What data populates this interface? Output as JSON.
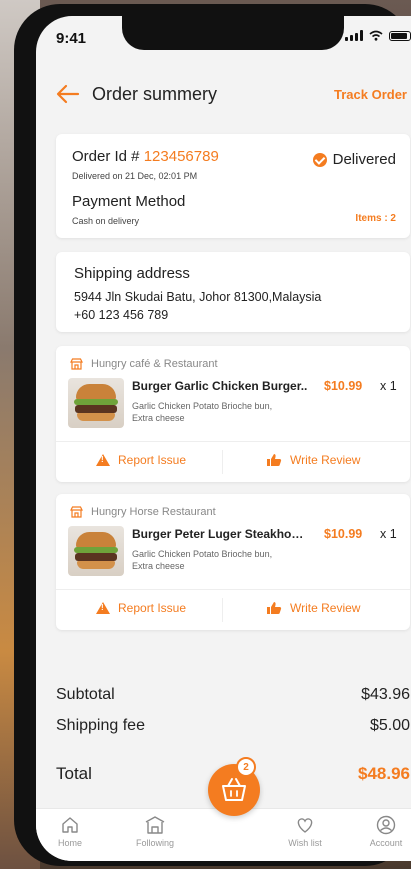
{
  "status_bar": {
    "time": "9:41"
  },
  "header": {
    "title": "Order summery",
    "track_label": "Track Order"
  },
  "order": {
    "id_label": "Order Id #",
    "id_value": "123456789",
    "delivered_on": "Delivered on 21 Dec, 02:01 PM",
    "status": "Delivered",
    "payment_title": "Payment Method",
    "payment_value": "Cash on delivery",
    "items_count": "Items : 2"
  },
  "shipping": {
    "title": "Shipping address",
    "address": "5944 Jln Skudai Batu, Johor 81300,Malaysia",
    "phone": "+60 123 456 789"
  },
  "orders": [
    {
      "restaurant": "Hungry café & Restaurant",
      "item_name": "Burger Garlic Chicken Burger..",
      "item_desc": "Garlic Chicken Potato Brioche bun, Extra cheese",
      "price": "$10.99",
      "qty": "x 1",
      "report_label": "Report Issue",
      "review_label": "Write Review"
    },
    {
      "restaurant": "Hungry Horse Restaurant",
      "item_name": "Burger Peter Luger Steakhouse..",
      "item_desc": "Garlic Chicken Potato Brioche bun, Extra cheese",
      "price": "$10.99",
      "qty": "x 1",
      "report_label": "Report Issue",
      "review_label": "Write Review"
    }
  ],
  "totals": {
    "subtotal_label": "Subtotal",
    "subtotal_value": "$43.96",
    "shipping_label": "Shipping fee",
    "shipping_value": "$5.00",
    "total_label": "Total",
    "total_value": "$48.96"
  },
  "cart": {
    "badge": "2"
  },
  "tabs": [
    {
      "label": "Home",
      "icon": "home-icon"
    },
    {
      "label": "Following",
      "icon": "store-icon"
    },
    {
      "label": "Wish list",
      "icon": "heart-icon"
    },
    {
      "label": "Account",
      "icon": "user-icon"
    }
  ],
  "colors": {
    "accent": "#f47c20",
    "background": "#f3f3f3",
    "card": "#ffffff"
  }
}
